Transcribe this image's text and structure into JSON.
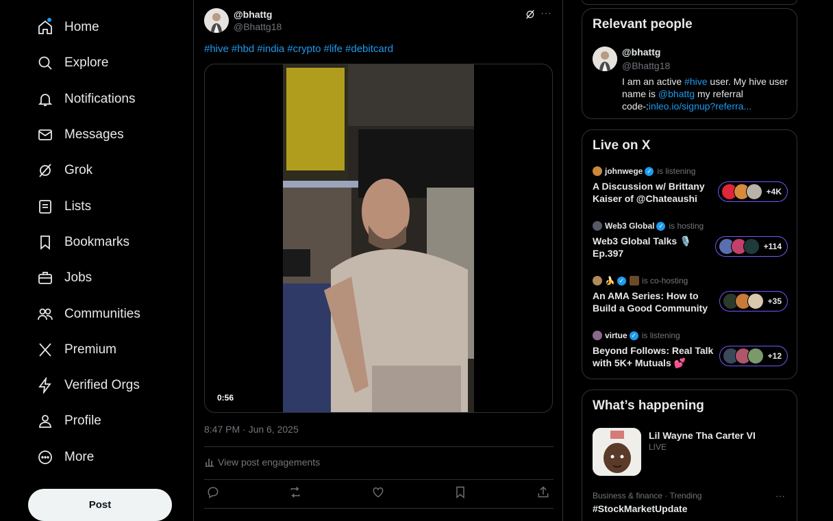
{
  "nav": {
    "items": [
      {
        "label": "Home",
        "icon": "home-icon",
        "notify": true
      },
      {
        "label": "Explore",
        "icon": "search-icon"
      },
      {
        "label": "Notifications",
        "icon": "bell-icon"
      },
      {
        "label": "Messages",
        "icon": "envelope-icon"
      },
      {
        "label": "Grok",
        "icon": "grok-icon"
      },
      {
        "label": "Lists",
        "icon": "list-icon"
      },
      {
        "label": "Bookmarks",
        "icon": "bookmark-icon"
      },
      {
        "label": "Jobs",
        "icon": "briefcase-icon"
      },
      {
        "label": "Communities",
        "icon": "people-icon"
      },
      {
        "label": "Premium",
        "icon": "x-logo-icon"
      },
      {
        "label": "Verified Orgs",
        "icon": "lightning-icon"
      },
      {
        "label": "Profile",
        "icon": "person-icon"
      },
      {
        "label": "More",
        "icon": "more-circle-icon"
      }
    ],
    "post_label": "Post"
  },
  "tweet": {
    "name": "@bhattg",
    "handle": "@Bhattg18",
    "hashtags": [
      "#hive",
      "#hbd",
      "#india",
      "#crypto",
      "#life",
      "#debitcard"
    ],
    "duration": "0:56",
    "timestamp": "8:47 PM · Jun 6, 2025",
    "engagements_label": "View post engagements"
  },
  "relevant_people": {
    "title": "Relevant people",
    "name": "@bhattg",
    "handle": "@Bhattg18",
    "bio_1": "I am an active ",
    "bio_link1": "#hive",
    "bio_2": " user. My hive user name is ",
    "bio_link2": "@bhattg",
    "bio_3": " my referral code-:",
    "bio_link3": "inleo.io/signup?referra..."
  },
  "live": {
    "title": "Live on X",
    "rows": [
      {
        "host": "johnwege",
        "status": "is listening",
        "title": "A Discussion w/ Brittany Kaiser  of @Chateaushi",
        "count": "+4K"
      },
      {
        "host": "Web3 Global",
        "status": "is hosting",
        "title": "Web3 Global Talks 🎙️ Ep.397",
        "count": "+114"
      },
      {
        "host": "🍌",
        "status": "is co-hosting",
        "title": "An AMA Series: How to Build a Good Community",
        "count": "+35"
      },
      {
        "host": "virtue",
        "status": "is listening",
        "title": "Beyond Follows: Real Talk with 5K+ Mutuals 💕",
        "count": "+12"
      }
    ]
  },
  "happening": {
    "title": "What’s happening",
    "item_title": "Lil Wayne Tha Carter VI",
    "item_status": "LIVE",
    "trend_category": "Business & finance · Trending",
    "trend_name": "#StockMarketUpdate"
  },
  "colors": {
    "accent": "#1d9bf0",
    "live_purple": "#7856ff",
    "border": "#2f3336",
    "muted": "#71767b"
  }
}
